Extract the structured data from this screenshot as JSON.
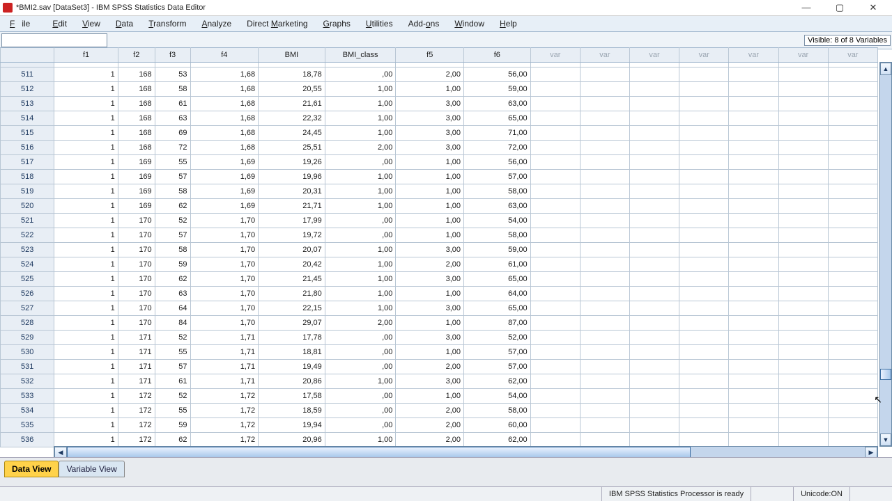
{
  "window": {
    "title": "*BMI2.sav [DataSet3] - IBM SPSS Statistics Data Editor"
  },
  "menu": {
    "file": "File",
    "edit": "Edit",
    "view": "View",
    "data": "Data",
    "transform": "Transform",
    "analyze": "Analyze",
    "direct_marketing": "Direct Marketing",
    "graphs": "Graphs",
    "utilities": "Utilities",
    "addons": "Add-ons",
    "window": "Window",
    "help": "Help"
  },
  "header_info": {
    "visible_vars": "Visible: 8 of 8 Variables"
  },
  "columns": {
    "f1": "f1",
    "f2": "f2",
    "f3": "f3",
    "f4": "f4",
    "bmi": "BMI",
    "bmi_class": "BMI_class",
    "f5": "f5",
    "f6": "f6",
    "var": "var"
  },
  "rows": [
    {
      "n": "511",
      "f1": "1",
      "f2": "168",
      "f3": "53",
      "f4": "1,68",
      "bmi": "18,78",
      "bmic": ",00",
      "f5": "2,00",
      "f6": "56,00"
    },
    {
      "n": "512",
      "f1": "1",
      "f2": "168",
      "f3": "58",
      "f4": "1,68",
      "bmi": "20,55",
      "bmic": "1,00",
      "f5": "1,00",
      "f6": "59,00"
    },
    {
      "n": "513",
      "f1": "1",
      "f2": "168",
      "f3": "61",
      "f4": "1,68",
      "bmi": "21,61",
      "bmic": "1,00",
      "f5": "3,00",
      "f6": "63,00"
    },
    {
      "n": "514",
      "f1": "1",
      "f2": "168",
      "f3": "63",
      "f4": "1,68",
      "bmi": "22,32",
      "bmic": "1,00",
      "f5": "3,00",
      "f6": "65,00"
    },
    {
      "n": "515",
      "f1": "1",
      "f2": "168",
      "f3": "69",
      "f4": "1,68",
      "bmi": "24,45",
      "bmic": "1,00",
      "f5": "3,00",
      "f6": "71,00"
    },
    {
      "n": "516",
      "f1": "1",
      "f2": "168",
      "f3": "72",
      "f4": "1,68",
      "bmi": "25,51",
      "bmic": "2,00",
      "f5": "3,00",
      "f6": "72,00"
    },
    {
      "n": "517",
      "f1": "1",
      "f2": "169",
      "f3": "55",
      "f4": "1,69",
      "bmi": "19,26",
      "bmic": ",00",
      "f5": "1,00",
      "f6": "56,00"
    },
    {
      "n": "518",
      "f1": "1",
      "f2": "169",
      "f3": "57",
      "f4": "1,69",
      "bmi": "19,96",
      "bmic": "1,00",
      "f5": "1,00",
      "f6": "57,00"
    },
    {
      "n": "519",
      "f1": "1",
      "f2": "169",
      "f3": "58",
      "f4": "1,69",
      "bmi": "20,31",
      "bmic": "1,00",
      "f5": "1,00",
      "f6": "58,00"
    },
    {
      "n": "520",
      "f1": "1",
      "f2": "169",
      "f3": "62",
      "f4": "1,69",
      "bmi": "21,71",
      "bmic": "1,00",
      "f5": "1,00",
      "f6": "63,00"
    },
    {
      "n": "521",
      "f1": "1",
      "f2": "170",
      "f3": "52",
      "f4": "1,70",
      "bmi": "17,99",
      "bmic": ",00",
      "f5": "1,00",
      "f6": "54,00"
    },
    {
      "n": "522",
      "f1": "1",
      "f2": "170",
      "f3": "57",
      "f4": "1,70",
      "bmi": "19,72",
      "bmic": ",00",
      "f5": "1,00",
      "f6": "58,00"
    },
    {
      "n": "523",
      "f1": "1",
      "f2": "170",
      "f3": "58",
      "f4": "1,70",
      "bmi": "20,07",
      "bmic": "1,00",
      "f5": "3,00",
      "f6": "59,00"
    },
    {
      "n": "524",
      "f1": "1",
      "f2": "170",
      "f3": "59",
      "f4": "1,70",
      "bmi": "20,42",
      "bmic": "1,00",
      "f5": "2,00",
      "f6": "61,00"
    },
    {
      "n": "525",
      "f1": "1",
      "f2": "170",
      "f3": "62",
      "f4": "1,70",
      "bmi": "21,45",
      "bmic": "1,00",
      "f5": "3,00",
      "f6": "65,00"
    },
    {
      "n": "526",
      "f1": "1",
      "f2": "170",
      "f3": "63",
      "f4": "1,70",
      "bmi": "21,80",
      "bmic": "1,00",
      "f5": "1,00",
      "f6": "64,00"
    },
    {
      "n": "527",
      "f1": "1",
      "f2": "170",
      "f3": "64",
      "f4": "1,70",
      "bmi": "22,15",
      "bmic": "1,00",
      "f5": "3,00",
      "f6": "65,00"
    },
    {
      "n": "528",
      "f1": "1",
      "f2": "170",
      "f3": "84",
      "f4": "1,70",
      "bmi": "29,07",
      "bmic": "2,00",
      "f5": "1,00",
      "f6": "87,00"
    },
    {
      "n": "529",
      "f1": "1",
      "f2": "171",
      "f3": "52",
      "f4": "1,71",
      "bmi": "17,78",
      "bmic": ",00",
      "f5": "3,00",
      "f6": "52,00"
    },
    {
      "n": "530",
      "f1": "1",
      "f2": "171",
      "f3": "55",
      "f4": "1,71",
      "bmi": "18,81",
      "bmic": ",00",
      "f5": "1,00",
      "f6": "57,00"
    },
    {
      "n": "531",
      "f1": "1",
      "f2": "171",
      "f3": "57",
      "f4": "1,71",
      "bmi": "19,49",
      "bmic": ",00",
      "f5": "2,00",
      "f6": "57,00"
    },
    {
      "n": "532",
      "f1": "1",
      "f2": "171",
      "f3": "61",
      "f4": "1,71",
      "bmi": "20,86",
      "bmic": "1,00",
      "f5": "3,00",
      "f6": "62,00"
    },
    {
      "n": "533",
      "f1": "1",
      "f2": "172",
      "f3": "52",
      "f4": "1,72",
      "bmi": "17,58",
      "bmic": ",00",
      "f5": "1,00",
      "f6": "54,00"
    },
    {
      "n": "534",
      "f1": "1",
      "f2": "172",
      "f3": "55",
      "f4": "1,72",
      "bmi": "18,59",
      "bmic": ",00",
      "f5": "2,00",
      "f6": "58,00"
    },
    {
      "n": "535",
      "f1": "1",
      "f2": "172",
      "f3": "59",
      "f4": "1,72",
      "bmi": "19,94",
      "bmic": ",00",
      "f5": "2,00",
      "f6": "60,00"
    },
    {
      "n": "536",
      "f1": "1",
      "f2": "172",
      "f3": "62",
      "f4": "1,72",
      "bmi": "20,96",
      "bmic": "1,00",
      "f5": "2,00",
      "f6": "62,00"
    }
  ],
  "tabs": {
    "data_view": "Data View",
    "variable_view": "Variable View"
  },
  "status": {
    "processor": "IBM SPSS Statistics Processor is ready",
    "unicode": "Unicode:ON"
  }
}
